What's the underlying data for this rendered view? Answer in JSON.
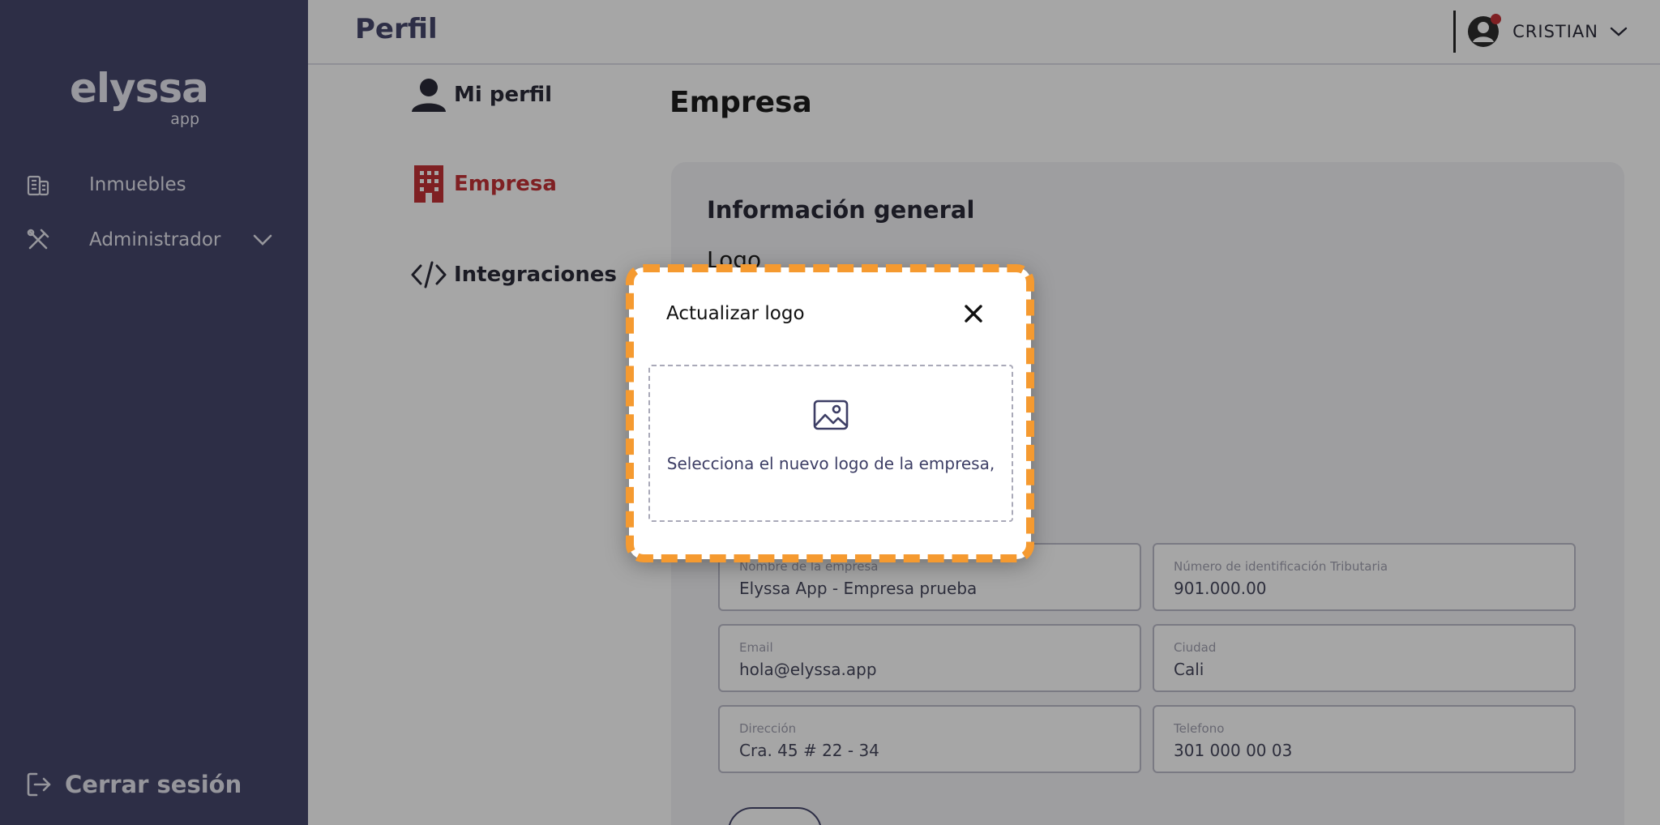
{
  "sidebar": {
    "logo_word": "elyssa",
    "logo_sub": "app",
    "items": [
      {
        "label": "Inmuebles",
        "icon": "building-icon"
      },
      {
        "label": "Administrador",
        "icon": "tools-icon"
      }
    ],
    "logout_label": "Cerrar sesión"
  },
  "header": {
    "title": "Perfil",
    "user_name": "CRISTIAN"
  },
  "profile_nav": {
    "items": [
      {
        "label": "Mi perfil",
        "icon": "user-icon"
      },
      {
        "label": "Empresa",
        "icon": "office-building-icon"
      },
      {
        "label": "Integraciones",
        "icon": "code-icon"
      }
    ]
  },
  "content": {
    "title": "Empresa",
    "section_title": "Información general",
    "logo_label": "Logo",
    "fields": [
      {
        "label": "Nombre de la empresa",
        "value": "Elyssa App - Empresa prueba"
      },
      {
        "label": "Número de identificación Tributaria",
        "value": "901.000.00"
      },
      {
        "label": "Email",
        "value": "hola@elyssa.app"
      },
      {
        "label": "Ciudad",
        "value": "Cali"
      },
      {
        "label": "Dirección",
        "value": "Cra. 45 # 22 - 34"
      },
      {
        "label": "Telefono",
        "value": "301 000 00 03"
      }
    ]
  },
  "modal": {
    "title": "Actualizar logo",
    "dropzone_text": "Selecciona el nuevo logo de la empresa,"
  },
  "colors": {
    "sidebar_bg": "#3d3e65",
    "accent_red": "#c0272d",
    "highlight_orange": "#f59a30"
  }
}
